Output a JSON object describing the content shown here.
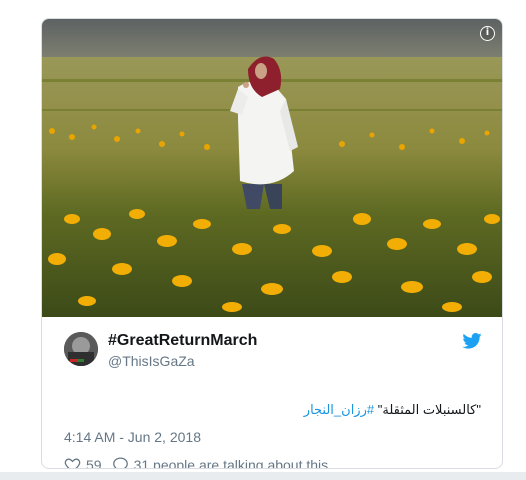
{
  "media": {
    "info_icon": "info-icon",
    "colors": {
      "sky": "#6b6f70",
      "field": "#8a8a3a",
      "flowers": "#f0a800"
    }
  },
  "tweet": {
    "display_name": "#GreatReturnMarch",
    "handle": "@ThisIsGaZa",
    "text_quote": "\"كالسنبلات المثقلة\"",
    "text_hashtag": "#رزان_النجار",
    "timestamp": "4:14 AM - Jun 2, 2018",
    "likes": "59",
    "talk_text": "31 people are talking about this",
    "icons": {
      "brand": "twitter-bird-icon",
      "like": "heart-icon",
      "reply": "speech-bubble-icon"
    },
    "colors": {
      "link": "#1b95e0",
      "text": "#14171a",
      "muted": "#657786"
    }
  }
}
